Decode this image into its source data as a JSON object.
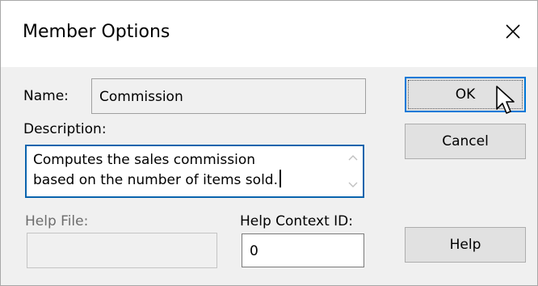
{
  "window": {
    "title": "Member Options",
    "close_icon": "close-icon"
  },
  "form": {
    "name_label": "Name:",
    "name_value": "Commission",
    "description_label": "Description:",
    "description_value": "Computes the sales commission\nbased on the number of items sold.",
    "help_file_label": "Help File:",
    "help_file_value": "",
    "help_context_label": "Help Context ID:",
    "help_context_value": "0"
  },
  "buttons": {
    "ok": "OK",
    "cancel": "Cancel",
    "help": "Help"
  },
  "colors": {
    "focus_border": "#0a64ad",
    "default_button_border": "#0078d7",
    "dialog_background": "#f0f0f0"
  }
}
